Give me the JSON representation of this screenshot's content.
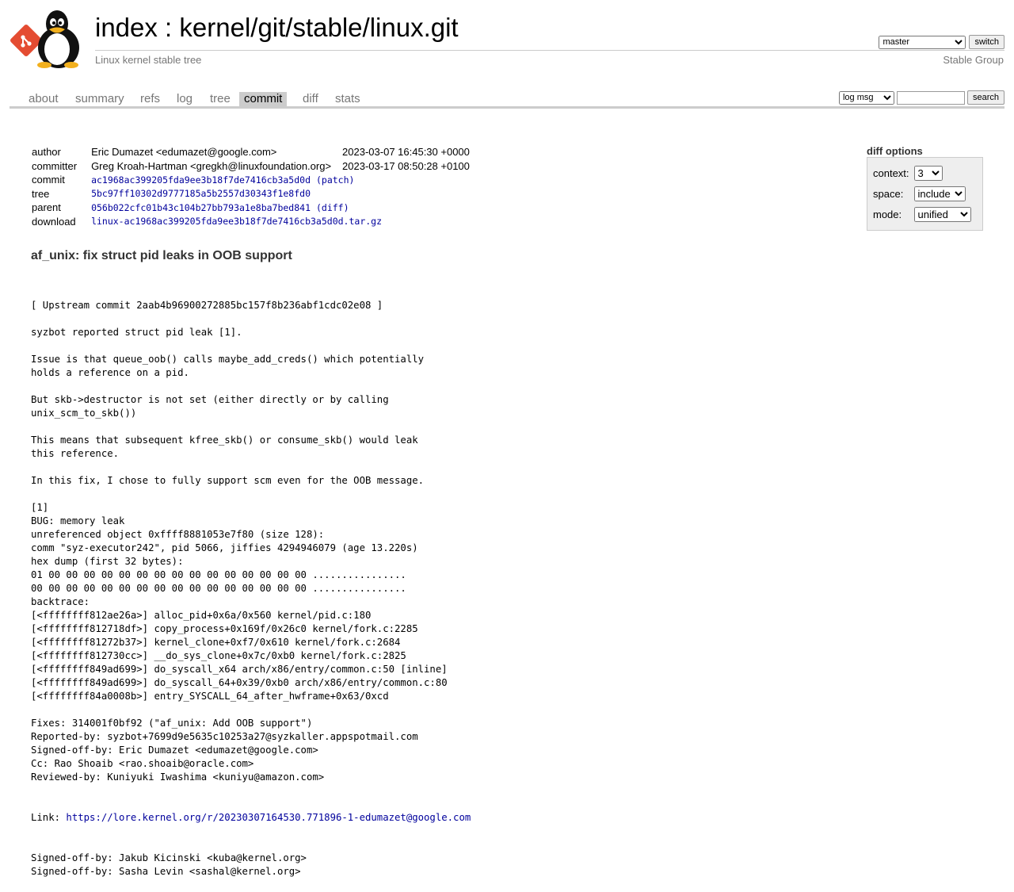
{
  "header": {
    "index_label": "index",
    "separator": " : ",
    "repo_path": "kernel/git/stable/linux.git",
    "description": "Linux kernel stable tree",
    "owner": "Stable Group",
    "branch_selected": "master",
    "switch_label": "switch"
  },
  "tabs": [
    {
      "label": "about"
    },
    {
      "label": "summary"
    },
    {
      "label": "refs"
    },
    {
      "label": "log"
    },
    {
      "label": "tree"
    },
    {
      "label": "commit"
    },
    {
      "label": "diff"
    },
    {
      "label": "stats"
    }
  ],
  "search": {
    "mode_selected": "log msg",
    "query": "",
    "button_label": "search"
  },
  "commit_info": {
    "author_label": "author",
    "author": "Eric Dumazet <edumazet@google.com>",
    "author_date": "2023-03-07 16:45:30 +0000",
    "committer_label": "committer",
    "committer": "Greg Kroah-Hartman <gregkh@linuxfoundation.org>",
    "committer_date": "2023-03-17 08:50:28 +0100",
    "commit_label": "commit",
    "commit_hash": "ac1968ac399205fda9ee3b18f7de7416cb3a5d0d",
    "patch_label": "patch",
    "tree_label": "tree",
    "tree_hash": "5bc97ff10302d9777185a5b2557d30343f1e8fd0",
    "parent_label": "parent",
    "parent_hash": "056b022cfc01b43c104b27bb793a1e8ba7bed841",
    "diff_label": "diff",
    "download_label": "download",
    "download_file": "linux-ac1968ac399205fda9ee3b18f7de7416cb3a5d0d.tar.gz"
  },
  "diff_options": {
    "title": "diff options",
    "context_label": "context:",
    "context_value": "3",
    "space_label": "space:",
    "space_value": "include",
    "mode_label": "mode:",
    "mode_value": "unified"
  },
  "commit_subject": "af_unix: fix struct pid leaks in OOB support",
  "commit_message_lines": [
    "[ Upstream commit 2aab4b96900272885bc157f8b236abf1cdc02e08 ]",
    "",
    "syzbot reported struct pid leak [1].",
    "",
    "Issue is that queue_oob() calls maybe_add_creds() which potentially",
    "holds a reference on a pid.",
    "",
    "But skb->destructor is not set (either directly or by calling",
    "unix_scm_to_skb())",
    "",
    "This means that subsequent kfree_skb() or consume_skb() would leak",
    "this reference.",
    "",
    "In this fix, I chose to fully support scm even for the OOB message.",
    "",
    "[1]",
    "BUG: memory leak",
    "unreferenced object 0xffff8881053e7f80 (size 128):",
    "comm \"syz-executor242\", pid 5066, jiffies 4294946079 (age 13.220s)",
    "hex dump (first 32 bytes):",
    "01 00 00 00 00 00 00 00 00 00 00 00 00 00 00 00 ................",
    "00 00 00 00 00 00 00 00 00 00 00 00 00 00 00 00 ................",
    "backtrace:",
    "[<ffffffff812ae26a>] alloc_pid+0x6a/0x560 kernel/pid.c:180",
    "[<ffffffff812718df>] copy_process+0x169f/0x26c0 kernel/fork.c:2285",
    "[<ffffffff81272b37>] kernel_clone+0xf7/0x610 kernel/fork.c:2684",
    "[<ffffffff812730cc>] __do_sys_clone+0x7c/0xb0 kernel/fork.c:2825",
    "[<ffffffff849ad699>] do_syscall_x64 arch/x86/entry/common.c:50 [inline]",
    "[<ffffffff849ad699>] do_syscall_64+0x39/0xb0 arch/x86/entry/common.c:80",
    "[<ffffffff84a0008b>] entry_SYSCALL_64_after_hwframe+0x63/0xcd",
    "",
    "Fixes: 314001f0bf92 (\"af_unix: Add OOB support\")",
    "Reported-by: syzbot+7699d9e5635c10253a27@syzkaller.appspotmail.com",
    "Signed-off-by: Eric Dumazet <edumazet@google.com>",
    "Cc: Rao Shoaib <rao.shoaib@oracle.com>",
    "Reviewed-by: Kuniyuki Iwashima <kuniyu@amazon.com>"
  ],
  "link_line": {
    "prefix": "Link: ",
    "url": "https://lore.kernel.org/r/20230307164530.771896-1-edumazet@google.com"
  },
  "commit_message_tail": [
    "Signed-off-by: Jakub Kicinski <kuba@kernel.org>",
    "Signed-off-by: Sasha Levin <sashal@kernel.org>"
  ]
}
